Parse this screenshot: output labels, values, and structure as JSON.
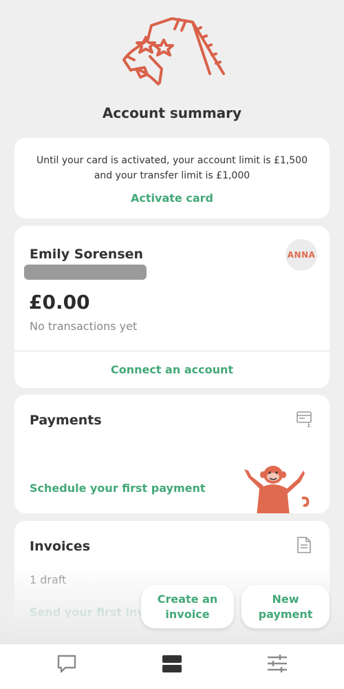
{
  "header": {
    "title": "Account summary",
    "illustration": "giraffe-illustration"
  },
  "notice": {
    "line1": "Until your card is activated, your account limit is £1,500",
    "line2": "and your transfer limit is £1,000",
    "action": "Activate card"
  },
  "account": {
    "name": "Emily Sorensen",
    "badge": "ANNA",
    "balance": "£0.00",
    "status": "No transactions yet",
    "action": "Connect an account"
  },
  "payments": {
    "title": "Payments",
    "icon": "payment-receipt-icon",
    "action": "Schedule your first payment",
    "illustration": "monkey-illustration"
  },
  "invoices": {
    "title": "Invoices",
    "icon": "document-icon",
    "drafts": "1 draft",
    "action": "Send your first invoice"
  },
  "fabs": {
    "create_invoice": "Create an\ninvoice",
    "new_payment": "New\npayment"
  },
  "nav": {
    "items": [
      {
        "icon": "chat-icon"
      },
      {
        "icon": "accounts-icon"
      },
      {
        "icon": "settings-sliders-icon"
      }
    ]
  },
  "colors": {
    "accent": "#43a878",
    "brand": "#e06a50",
    "background": "#efefef"
  }
}
